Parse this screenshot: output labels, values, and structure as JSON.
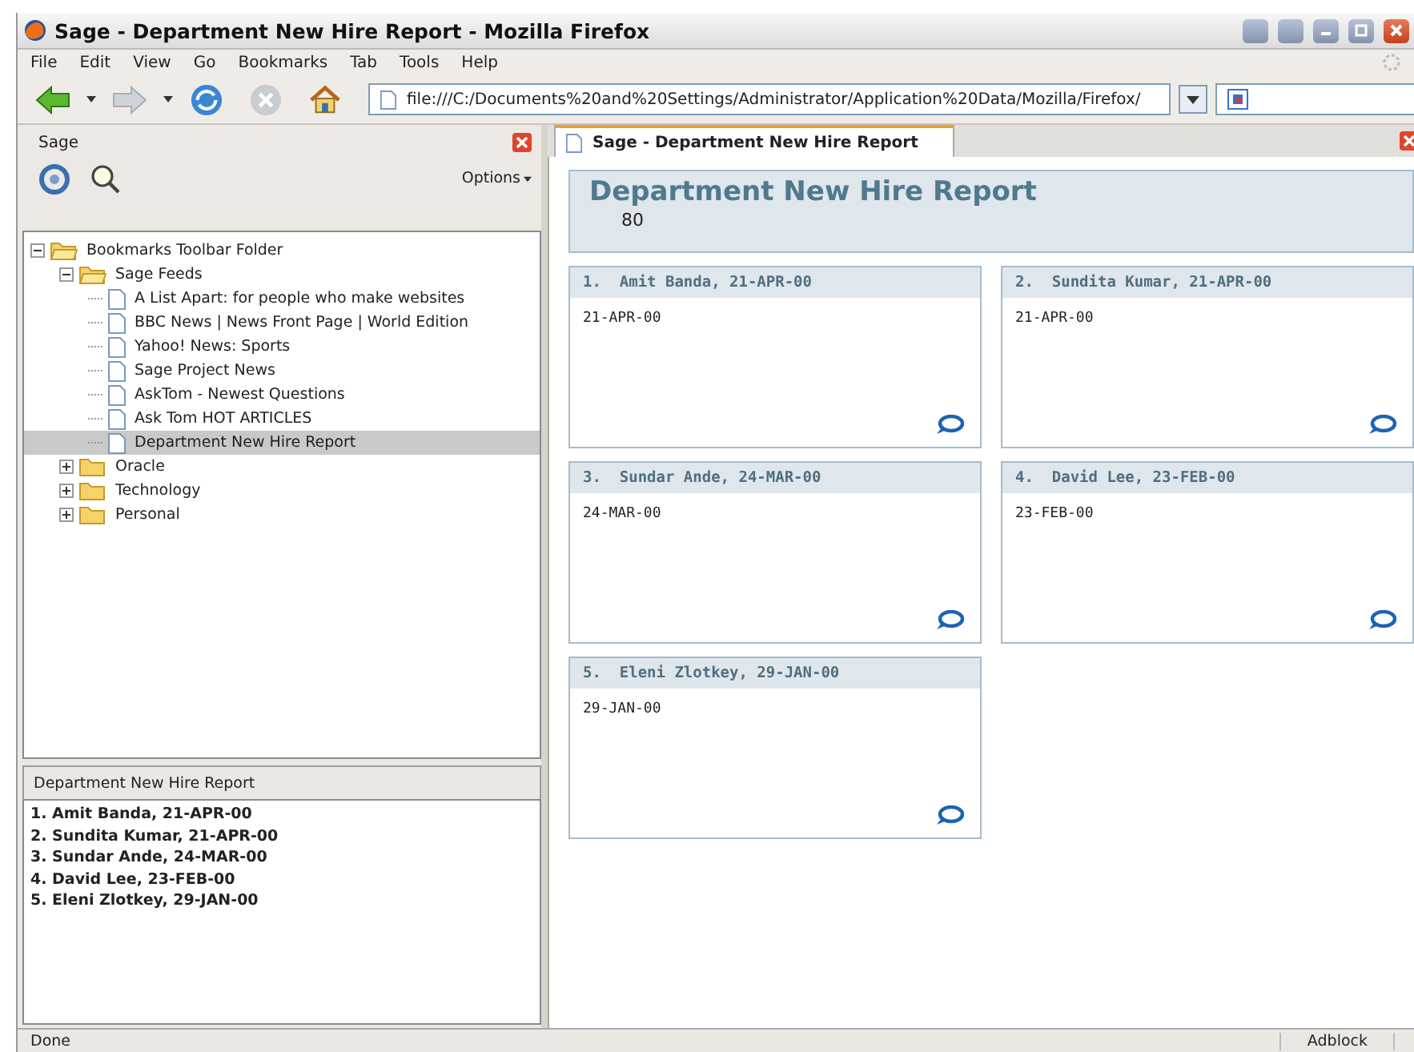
{
  "window": {
    "title": "Sage - Department New Hire Report - Mozilla Firefox"
  },
  "menu": [
    {
      "label": "File"
    },
    {
      "label": "Edit"
    },
    {
      "label": "View"
    },
    {
      "label": "Go"
    },
    {
      "label": "Bookmarks"
    },
    {
      "label": "Tab"
    },
    {
      "label": "Tools"
    },
    {
      "label": "Help"
    }
  ],
  "address": {
    "url": "file:///C:/Documents%20and%20Settings/Administrator/Application%20Data/Mozilla/Firefox/"
  },
  "sidebar": {
    "title": "Sage",
    "options_label": "Options",
    "tree": [
      {
        "kind": "folder",
        "label": "Bookmarks Toolbar Folder",
        "expanded": true,
        "selected": false,
        "children": [
          {
            "kind": "folder",
            "label": "Sage Feeds",
            "expanded": true,
            "selected": false,
            "children": [
              {
                "kind": "feed",
                "label": "A List Apart: for people who make websites",
                "selected": false
              },
              {
                "kind": "feed",
                "label": "BBC News | News Front Page | World Edition",
                "selected": false
              },
              {
                "kind": "feed",
                "label": "Yahoo! News: Sports",
                "selected": false
              },
              {
                "kind": "feed",
                "label": "Sage Project News",
                "selected": false
              },
              {
                "kind": "feed",
                "label": "AskTom - Newest Questions",
                "selected": false
              },
              {
                "kind": "feed",
                "label": "Ask Tom HOT ARTICLES",
                "selected": false
              },
              {
                "kind": "feed",
                "label": "Department New Hire Report",
                "selected": true
              }
            ]
          },
          {
            "kind": "folder",
            "label": "Oracle",
            "expanded": false,
            "selected": false
          },
          {
            "kind": "folder",
            "label": "Technology",
            "expanded": false,
            "selected": false
          },
          {
            "kind": "folder",
            "label": "Personal",
            "expanded": false,
            "selected": false
          }
        ]
      }
    ],
    "preview": {
      "title": "Department New Hire Report",
      "items": [
        "1. Amit Banda, 21-APR-00",
        "2. Sundita Kumar, 21-APR-00",
        "3. Sundar Ande, 24-MAR-00",
        "4. David Lee, 23-FEB-00",
        "5. Eleni Zlotkey, 29-JAN-00"
      ]
    }
  },
  "tab": {
    "label": "Sage - Department New Hire Report",
    "selected": true
  },
  "report": {
    "title": "Department New Hire Report",
    "subtitle": "80",
    "cards": [
      {
        "heading": "1.  Amit Banda, 21-APR-00",
        "date": "21-APR-00"
      },
      {
        "heading": "2.  Sundita Kumar, 21-APR-00",
        "date": "21-APR-00"
      },
      {
        "heading": "3.  Sundar Ande, 24-MAR-00",
        "date": "24-MAR-00"
      },
      {
        "heading": "4.  David Lee, 23-FEB-00",
        "date": "23-FEB-00"
      },
      {
        "heading": "5.  Eleni Zlotkey, 29-JAN-00",
        "date": "29-JAN-00"
      }
    ]
  },
  "status_bar": {
    "text": "Done",
    "addon": "Adblock"
  }
}
